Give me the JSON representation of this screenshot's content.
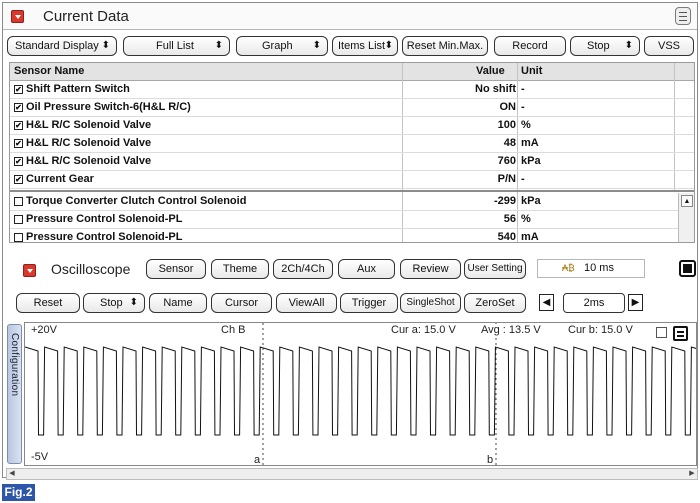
{
  "current_data": {
    "title": "Current Data",
    "toolbar": [
      {
        "label": "Standard Display",
        "arrow": "⬍"
      },
      {
        "label": "Full List",
        "arrow": "⬍"
      },
      {
        "label": "Graph",
        "arrow": "⬍"
      },
      {
        "label": "Items List",
        "arrow": "⬍"
      },
      {
        "label": "Reset Min.Max.",
        "arrow": ""
      },
      {
        "label": "Record",
        "arrow": ""
      },
      {
        "label": "Stop",
        "arrow": "⬍"
      },
      {
        "label": "VSS",
        "arrow": ""
      }
    ],
    "columns": {
      "name": "Sensor Name",
      "value": "Value",
      "unit": "Unit"
    },
    "rows": [
      {
        "checked": true,
        "name": "Shift Pattern Switch",
        "value": "No shift",
        "unit": "-"
      },
      {
        "checked": true,
        "name": "Oil Pressure Switch-6(H&L R/C)",
        "value": "ON",
        "unit": "-"
      },
      {
        "checked": true,
        "name": "H&L R/C Solenoid Valve",
        "value": "100",
        "unit": "%"
      },
      {
        "checked": true,
        "name": "H&L R/C Solenoid Valve",
        "value": "48",
        "unit": "mA"
      },
      {
        "checked": true,
        "name": "H&L R/C Solenoid Valve",
        "value": "760",
        "unit": "kPa"
      },
      {
        "checked": true,
        "name": "Current Gear",
        "value": "P/N",
        "unit": "-"
      },
      {
        "checked": false,
        "name": "Torque Converter Clutch Control Solenoid",
        "value": "-299",
        "unit": "kPa"
      },
      {
        "checked": false,
        "name": "Pressure Control Solenoid-PL",
        "value": "56",
        "unit": "%"
      },
      {
        "checked": false,
        "name": "Pressure Control Solenoid-PL",
        "value": "540",
        "unit": "mA"
      }
    ]
  },
  "oscilloscope": {
    "title": "Oscilloscope",
    "top_buttons": [
      "Sensor",
      "Theme",
      "2Ch/4Ch",
      "Aux",
      "Review",
      "User Setting"
    ],
    "timebase": "10 ms",
    "bottom_buttons": [
      {
        "label": "Reset",
        "arrow": ""
      },
      {
        "label": "Stop",
        "arrow": "⬍"
      },
      {
        "label": "Name",
        "arrow": ""
      },
      {
        "label": "Cursor",
        "arrow": ""
      },
      {
        "label": "ViewAll",
        "arrow": ""
      },
      {
        "label": "Trigger",
        "arrow": ""
      },
      {
        "label": "SingleShot",
        "arrow": ""
      },
      {
        "label": "ZeroSet",
        "arrow": ""
      }
    ],
    "time_div": "2ms",
    "config_tab": "Configuration",
    "display": {
      "y_max": "+20V",
      "y_min": "-5V",
      "channel": "Ch B",
      "cur_a": "Cur a: 15.0 V",
      "avg": "Avg : 13.5 V",
      "cur_b": "Cur b: 15.0 V",
      "cursor_a": "a",
      "cursor_b": "b"
    }
  },
  "figure_label": "Fig.2",
  "colors": {
    "accent_red": "#d9382c",
    "fig_blue": "#2d55a8",
    "config_tab": "#b9c7e0"
  }
}
